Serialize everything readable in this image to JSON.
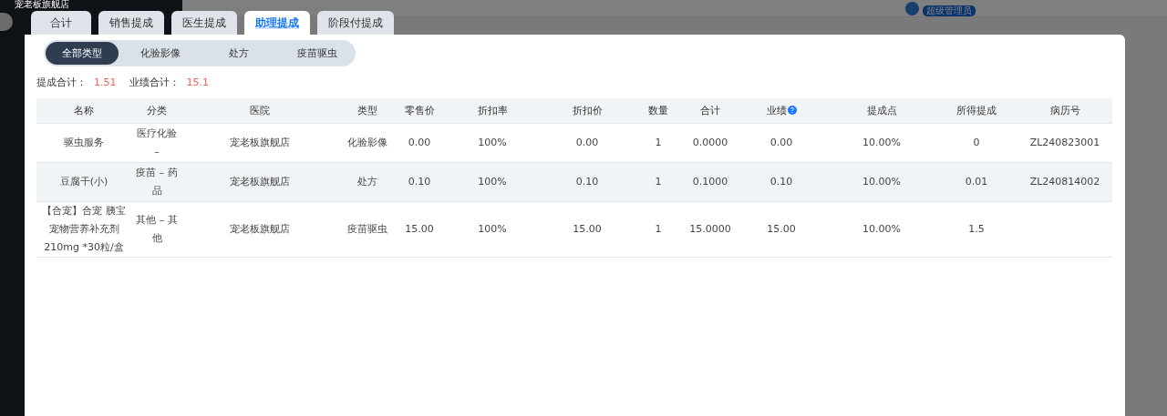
{
  "app": {
    "store_name": "宠老板旗舰店",
    "role_badge": "超级管理员"
  },
  "dialog": {
    "tabs": [
      {
        "label": "合计",
        "selected": false
      },
      {
        "label": "销售提成",
        "selected": false
      },
      {
        "label": "医生提成",
        "selected": false
      },
      {
        "label": "助理提成",
        "selected": true
      },
      {
        "label": "阶段付提成",
        "selected": false
      }
    ],
    "type_filter": [
      {
        "label": "全部类型",
        "selected": true
      },
      {
        "label": "化验影像",
        "selected": false
      },
      {
        "label": "处方",
        "selected": false
      },
      {
        "label": "疫苗驱虫",
        "selected": false
      }
    ],
    "summary": [
      {
        "label": "提成合计：",
        "value": "1.51"
      },
      {
        "label": "业绩合计：",
        "value": "15.1"
      }
    ],
    "table": {
      "columns": [
        {
          "label": "名称"
        },
        {
          "label": "分类"
        },
        {
          "label": "医院"
        },
        {
          "label": "类型"
        },
        {
          "label": "零售价"
        },
        {
          "label": "折扣率"
        },
        {
          "label": "折扣价"
        },
        {
          "label": "数量"
        },
        {
          "label": "合计"
        },
        {
          "label": "业绩",
          "help": true
        },
        {
          "label": "提成点"
        },
        {
          "label": "所得提成"
        },
        {
          "label": "病历号"
        }
      ],
      "rows": [
        [
          "驱虫服务",
          "医疗化验 –",
          "宠老板旗舰店",
          "化验影像",
          "0.00",
          "100%",
          "0.00",
          "1",
          "0.0000",
          "0.00",
          "10.00%",
          "0",
          "ZL240823001"
        ],
        [
          "豆腐干(小)",
          "疫苗 – 药品",
          "宠老板旗舰店",
          "处方",
          "0.10",
          "100%",
          "0.10",
          "1",
          "0.1000",
          "0.10",
          "10.00%",
          "0.01",
          "ZL240814002"
        ],
        [
          "【合宠】合宠 胰宝宠物营养补充剂 210mg *30粒/盒",
          "其他 – 其他",
          "宠老板旗舰店",
          "疫苗驱虫",
          "15.00",
          "100%",
          "15.00",
          "1",
          "15.0000",
          "15.00",
          "10.00%",
          "1.5"
        ]
      ]
    }
  }
}
